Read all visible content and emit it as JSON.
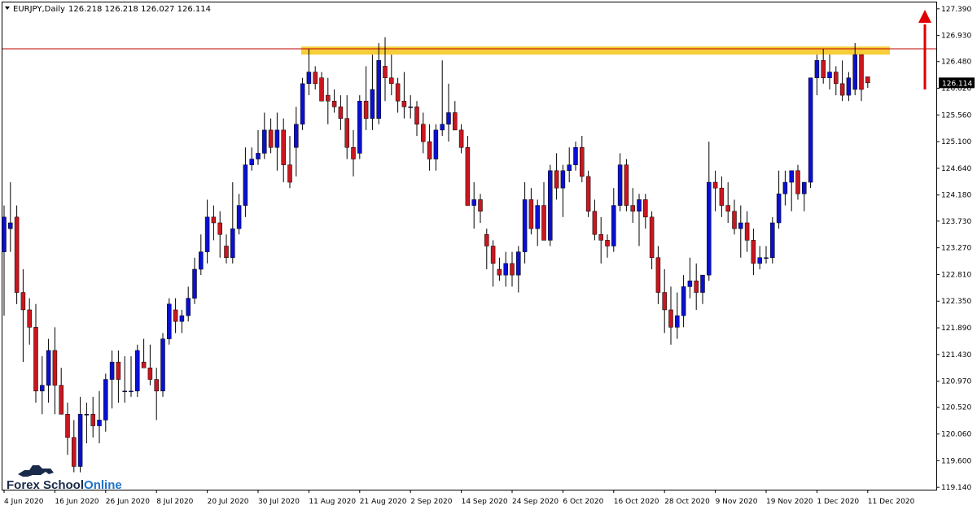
{
  "header": {
    "symbol_timeframe": "EURJPY,Daily",
    "ohlc": "126.218 126.218 126.027 126.114"
  },
  "price_label": "126.114",
  "logo": {
    "part1": "Forex School",
    "part2": "Online"
  },
  "colors": {
    "bull": "#0a10d0",
    "bear": "#c8171f",
    "wick": "#000000",
    "zone": "#f5c518",
    "resistance_line": "#c00000",
    "arrow": "#e00000",
    "price_label_bg": "#000000"
  },
  "chart_data": {
    "type": "candlestick",
    "symbol": "EURJPY",
    "timeframe": "Daily",
    "ylim": [
      119.1,
      127.5
    ],
    "y_ticks": [
      127.39,
      126.93,
      126.48,
      126.02,
      125.56,
      125.1,
      124.64,
      124.18,
      123.73,
      123.27,
      122.81,
      122.35,
      121.89,
      121.43,
      120.97,
      120.52,
      120.06,
      119.6,
      119.14
    ],
    "y_tick_labels": [
      "127.390",
      "126.930",
      "126.480",
      "126.020",
      "125.560",
      "125.100",
      "124.640",
      "124.180",
      "123.730",
      "123.270",
      "122.810",
      "122.350",
      "121.890",
      "121.430",
      "120.970",
      "120.520",
      "120.060",
      "119.600",
      "119.140"
    ],
    "x_labels": [
      "4 Jun 2020",
      "16 Jun 2020",
      "26 Jun 2020",
      "8 Jul 2020",
      "20 Jul 2020",
      "30 Jul 2020",
      "11 Aug 2020",
      "21 Aug 2020",
      "2 Sep 2020",
      "14 Sep 2020",
      "24 Sep 2020",
      "6 Oct 2020",
      "16 Oct 2020",
      "28 Oct 2020",
      "9 Nov 2020",
      "19 Nov 2020",
      "1 Dec 2020",
      "11 Dec 2020"
    ],
    "x_label_bar_index": [
      0,
      8,
      16,
      24,
      32,
      40,
      48,
      56,
      64,
      72,
      80,
      88,
      96,
      104,
      112,
      120,
      128,
      136
    ],
    "resistance_level": 126.7,
    "resistance_zone": [
      126.6,
      126.74
    ],
    "last_price": 126.114,
    "annotations": [
      "upward arrow at right edge indicating expected breakout above resistance"
    ],
    "candles": [
      [
        123.2,
        124.0,
        122.1,
        123.8
      ],
      [
        123.6,
        124.4,
        123.2,
        123.7
      ],
      [
        123.8,
        124.0,
        122.3,
        122.5
      ],
      [
        122.5,
        122.9,
        121.3,
        122.2
      ],
      [
        122.2,
        122.4,
        121.6,
        121.9
      ],
      [
        121.9,
        122.3,
        120.6,
        120.8
      ],
      [
        120.8,
        121.4,
        120.4,
        120.9
      ],
      [
        120.9,
        121.7,
        120.6,
        121.5
      ],
      [
        121.5,
        121.9,
        120.4,
        120.9
      ],
      [
        120.9,
        121.2,
        120.4,
        120.4
      ],
      [
        120.4,
        120.6,
        119.7,
        120.0
      ],
      [
        120.0,
        120.3,
        119.4,
        119.5
      ],
      [
        119.5,
        120.7,
        119.4,
        120.4
      ],
      [
        120.4,
        120.6,
        119.9,
        120.4
      ],
      [
        120.4,
        120.7,
        120.0,
        120.2
      ],
      [
        120.2,
        120.8,
        119.9,
        120.3
      ],
      [
        120.3,
        121.1,
        120.1,
        121.0
      ],
      [
        121.0,
        121.5,
        120.5,
        121.3
      ],
      [
        121.3,
        121.5,
        120.6,
        121.0
      ],
      [
        120.8,
        121.4,
        120.6,
        120.8
      ],
      [
        120.8,
        121.4,
        120.7,
        120.8
      ],
      [
        120.8,
        121.6,
        120.7,
        121.5
      ],
      [
        121.3,
        121.7,
        121.2,
        121.2
      ],
      [
        121.2,
        121.6,
        120.9,
        121.0
      ],
      [
        121.0,
        121.2,
        120.3,
        120.8
      ],
      [
        120.8,
        121.8,
        120.7,
        121.7
      ],
      [
        121.7,
        122.4,
        121.6,
        122.3
      ],
      [
        122.2,
        122.4,
        121.8,
        122.0
      ],
      [
        122.0,
        122.2,
        121.8,
        122.1
      ],
      [
        122.1,
        122.6,
        122.0,
        122.4
      ],
      [
        122.4,
        123.1,
        122.3,
        122.9
      ],
      [
        122.9,
        123.5,
        122.8,
        123.2
      ],
      [
        123.2,
        124.1,
        123.0,
        123.8
      ],
      [
        123.8,
        124.0,
        123.4,
        123.7
      ],
      [
        123.7,
        123.9,
        123.1,
        123.5
      ],
      [
        123.3,
        123.5,
        123.0,
        123.1
      ],
      [
        123.1,
        124.4,
        123.0,
        123.6
      ],
      [
        123.6,
        124.2,
        123.5,
        124.0
      ],
      [
        124.0,
        125.0,
        123.8,
        124.7
      ],
      [
        124.7,
        125.0,
        124.6,
        124.8
      ],
      [
        124.8,
        125.3,
        124.7,
        124.9
      ],
      [
        124.9,
        125.6,
        124.8,
        125.3
      ],
      [
        125.3,
        125.5,
        124.9,
        125.0
      ],
      [
        125.0,
        125.6,
        124.6,
        125.3
      ],
      [
        125.3,
        125.5,
        124.4,
        124.7
      ],
      [
        124.7,
        125.2,
        124.3,
        124.4
      ],
      [
        125.0,
        125.7,
        124.5,
        125.4
      ],
      [
        125.4,
        126.2,
        125.3,
        126.1
      ],
      [
        126.1,
        126.7,
        125.9,
        126.3
      ],
      [
        126.3,
        126.4,
        126.0,
        126.1
      ],
      [
        126.2,
        126.3,
        125.9,
        125.8
      ],
      [
        125.9,
        126.2,
        125.4,
        125.8
      ],
      [
        125.8,
        126.0,
        125.6,
        125.7
      ],
      [
        125.7,
        125.9,
        125.3,
        125.5
      ],
      [
        125.5,
        125.9,
        124.8,
        125.0
      ],
      [
        125.0,
        125.3,
        124.5,
        124.8
      ],
      [
        124.9,
        125.9,
        124.8,
        125.8
      ],
      [
        125.8,
        126.4,
        125.3,
        125.5
      ],
      [
        125.5,
        126.6,
        125.3,
        126.0
      ],
      [
        125.5,
        126.8,
        125.4,
        126.5
      ],
      [
        126.4,
        126.9,
        125.8,
        126.2
      ],
      [
        126.2,
        126.6,
        125.9,
        126.1
      ],
      [
        126.1,
        126.2,
        125.6,
        125.8
      ],
      [
        125.8,
        126.3,
        125.5,
        125.7
      ],
      [
        125.7,
        125.9,
        125.5,
        125.7
      ],
      [
        125.7,
        125.8,
        125.2,
        125.4
      ],
      [
        125.4,
        125.6,
        124.9,
        125.1
      ],
      [
        125.1,
        125.4,
        124.6,
        124.8
      ],
      [
        124.8,
        125.4,
        124.6,
        125.3
      ],
      [
        125.3,
        126.5,
        125.2,
        125.4
      ],
      [
        125.4,
        126.1,
        125.1,
        125.6
      ],
      [
        125.6,
        125.8,
        125.3,
        125.3
      ],
      [
        125.3,
        125.4,
        124.9,
        125.0
      ],
      [
        125.0,
        125.2,
        124.1,
        124.0
      ],
      [
        124.0,
        124.4,
        123.6,
        124.1
      ],
      [
        124.1,
        124.2,
        123.7,
        123.9
      ],
      [
        123.5,
        123.6,
        122.9,
        123.3
      ],
      [
        123.3,
        123.4,
        122.6,
        123.0
      ],
      [
        122.9,
        123.1,
        122.7,
        122.8
      ],
      [
        122.8,
        123.2,
        122.6,
        123.0
      ],
      [
        123.0,
        123.2,
        122.6,
        122.8
      ],
      [
        122.8,
        123.3,
        122.5,
        123.2
      ],
      [
        123.2,
        124.4,
        123.0,
        124.1
      ],
      [
        124.1,
        124.3,
        123.5,
        123.6
      ],
      [
        123.6,
        124.1,
        123.3,
        124.0
      ],
      [
        124.0,
        124.4,
        123.4,
        123.4
      ],
      [
        123.4,
        124.7,
        123.3,
        124.6
      ],
      [
        124.6,
        124.9,
        124.1,
        124.3
      ],
      [
        124.3,
        124.7,
        123.8,
        124.6
      ],
      [
        124.6,
        125.0,
        124.4,
        124.7
      ],
      [
        124.7,
        125.1,
        124.6,
        125.0
      ],
      [
        125.0,
        125.2,
        124.4,
        124.5
      ],
      [
        124.5,
        124.6,
        123.8,
        123.9
      ],
      [
        123.9,
        124.1,
        123.4,
        123.5
      ],
      [
        123.5,
        123.8,
        123.0,
        123.4
      ],
      [
        123.4,
        123.5,
        123.1,
        123.3
      ],
      [
        123.3,
        124.3,
        123.2,
        124.0
      ],
      [
        124.0,
        124.9,
        123.9,
        124.7
      ],
      [
        124.7,
        124.8,
        123.9,
        124.0
      ],
      [
        124.0,
        124.3,
        123.7,
        123.9
      ],
      [
        123.9,
        124.2,
        123.3,
        124.1
      ],
      [
        124.1,
        124.2,
        123.6,
        123.8
      ],
      [
        123.8,
        123.9,
        122.9,
        123.1
      ],
      [
        123.1,
        123.3,
        122.3,
        122.5
      ],
      [
        122.5,
        122.9,
        121.8,
        122.2
      ],
      [
        122.2,
        122.6,
        121.6,
        121.9
      ],
      [
        121.9,
        122.5,
        121.7,
        122.1
      ],
      [
        122.1,
        122.8,
        121.9,
        122.6
      ],
      [
        122.6,
        123.1,
        122.4,
        122.7
      ],
      [
        122.7,
        123.0,
        122.2,
        122.5
      ],
      [
        122.5,
        122.8,
        122.3,
        122.8
      ],
      [
        122.8,
        125.1,
        122.7,
        124.4
      ],
      [
        124.4,
        124.6,
        123.9,
        124.3
      ],
      [
        124.3,
        124.5,
        123.8,
        124.0
      ],
      [
        124.0,
        124.4,
        123.7,
        123.9
      ],
      [
        123.9,
        124.1,
        123.5,
        123.6
      ],
      [
        123.6,
        124.0,
        123.1,
        123.7
      ],
      [
        123.7,
        123.9,
        123.2,
        123.4
      ],
      [
        123.4,
        123.6,
        122.8,
        123.0
      ],
      [
        123.0,
        123.3,
        122.9,
        123.1
      ],
      [
        123.1,
        123.3,
        123.0,
        123.1
      ],
      [
        123.1,
        123.8,
        123.0,
        123.7
      ],
      [
        123.7,
        124.6,
        123.6,
        124.2
      ],
      [
        124.2,
        124.6,
        124.0,
        124.4
      ],
      [
        124.4,
        124.6,
        123.9,
        124.6
      ],
      [
        124.6,
        124.7,
        124.1,
        124.2
      ],
      [
        124.2,
        124.4,
        123.9,
        124.4
      ],
      [
        124.4,
        125.1,
        124.3,
        126.2
      ],
      [
        126.2,
        126.6,
        125.9,
        126.5
      ],
      [
        126.5,
        126.7,
        126.1,
        126.2
      ],
      [
        126.2,
        126.6,
        126.0,
        126.3
      ],
      [
        126.3,
        126.4,
        125.9,
        126.1
      ],
      [
        126.1,
        126.5,
        125.8,
        125.9
      ],
      [
        125.9,
        126.3,
        125.8,
        126.2
      ],
      [
        126.0,
        126.8,
        125.9,
        126.6
      ],
      [
        126.6,
        126.6,
        125.8,
        126.0
      ],
      [
        126.218,
        126.218,
        126.027,
        126.114
      ]
    ]
  }
}
